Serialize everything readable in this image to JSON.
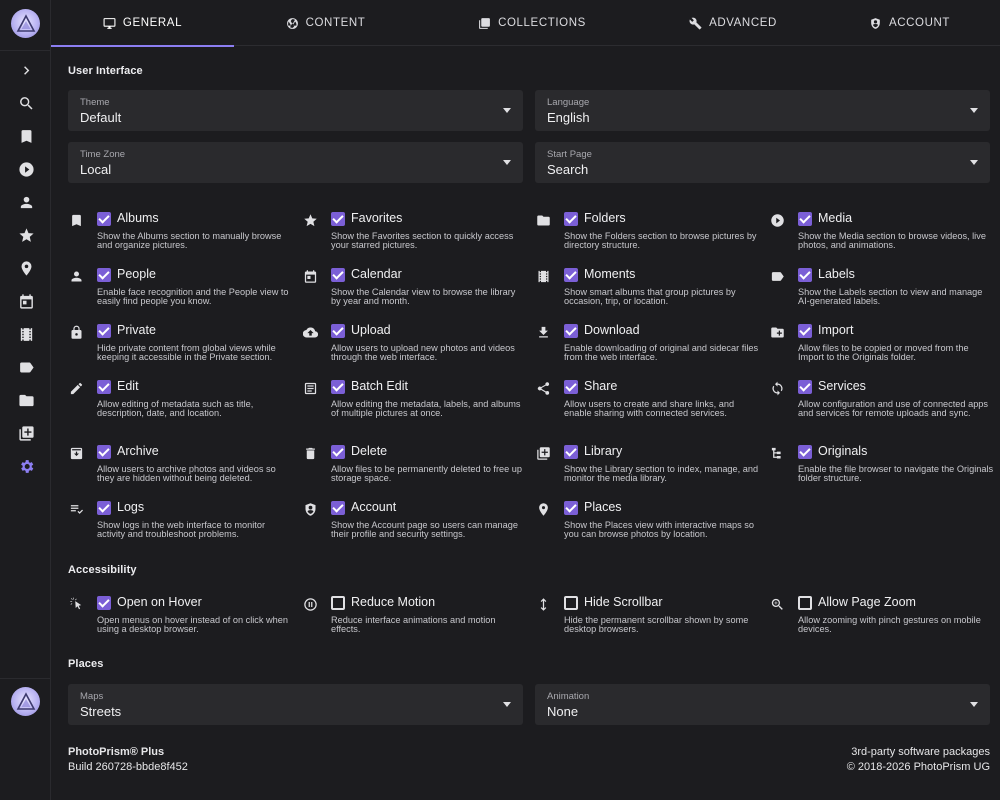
{
  "tabs": [
    {
      "label": "GENERAL",
      "icon": "monitor-icon"
    },
    {
      "label": "CONTENT",
      "icon": "aperture-icon"
    },
    {
      "label": "COLLECTIONS",
      "icon": "collections-icon"
    },
    {
      "label": "ADVANCED",
      "icon": "wrench-icon"
    },
    {
      "label": "ACCOUNT",
      "icon": "account-icon"
    }
  ],
  "accent_color": "#8c7ef2",
  "sections": {
    "ui_title": "User Interface",
    "accessibility_title": "Accessibility",
    "places_title": "Places"
  },
  "selects": {
    "theme": {
      "label": "Theme",
      "value": "Default"
    },
    "language": {
      "label": "Language",
      "value": "English"
    },
    "timezone": {
      "label": "Time Zone",
      "value": "Local"
    },
    "startpage": {
      "label": "Start Page",
      "value": "Search"
    },
    "maps": {
      "label": "Maps",
      "value": "Streets"
    },
    "animation": {
      "label": "Animation",
      "value": "None"
    }
  },
  "options": [
    {
      "name": "Albums",
      "desc": "Show the Albums section to manually browse and organize pictures.",
      "checked": true,
      "icon": "bookmark-icon"
    },
    {
      "name": "Favorites",
      "desc": "Show the Favorites section to quickly access your starred pictures.",
      "checked": true,
      "icon": "star-icon"
    },
    {
      "name": "Folders",
      "desc": "Show the Folders section to browse pictures by directory structure.",
      "checked": true,
      "icon": "folder-icon"
    },
    {
      "name": "Media",
      "desc": "Show the Media section to browse videos, live photos, and animations.",
      "checked": true,
      "icon": "play-circle-icon"
    },
    {
      "name": "People",
      "desc": "Enable face recognition and the People view to easily find people you know.",
      "checked": true,
      "icon": "person-icon"
    },
    {
      "name": "Calendar",
      "desc": "Show the Calendar view to browse the library by year and month.",
      "checked": true,
      "icon": "calendar-icon"
    },
    {
      "name": "Moments",
      "desc": "Show smart albums that group pictures by occasion, trip, or location.",
      "checked": true,
      "icon": "film-icon"
    },
    {
      "name": "Labels",
      "desc": "Show the Labels section to view and manage AI-generated labels.",
      "checked": true,
      "icon": "label-icon"
    },
    {
      "name": "Private",
      "desc": "Hide private content from global views while keeping it accessible in the Private section.",
      "checked": true,
      "icon": "lock-icon"
    },
    {
      "name": "Upload",
      "desc": "Allow users to upload new photos and videos through the web interface.",
      "checked": true,
      "icon": "cloud-upload-icon"
    },
    {
      "name": "Download",
      "desc": "Enable downloading of original and sidecar files from the web interface.",
      "checked": true,
      "icon": "download-icon"
    },
    {
      "name": "Import",
      "desc": "Allow files to be copied or moved from the Import to the Originals folder.",
      "checked": true,
      "icon": "folder-plus-icon"
    },
    {
      "name": "Edit",
      "desc": "Allow editing of metadata such as title, description, date, and location.",
      "checked": true,
      "icon": "pencil-icon"
    },
    {
      "name": "Batch Edit",
      "desc": "Allow editing the metadata, labels, and albums of multiple pictures at once.",
      "checked": true,
      "icon": "batch-edit-icon"
    },
    {
      "name": "Share",
      "desc": "Allow users to create and share links, and enable sharing with connected services.",
      "checked": true,
      "icon": "share-icon"
    },
    {
      "name": "Services",
      "desc": "Allow configuration and use of connected apps and services for remote uploads and sync.",
      "checked": true,
      "icon": "sync-icon"
    },
    {
      "name": "Archive",
      "desc": "Allow users to archive photos and videos so they are hidden without being deleted.",
      "checked": true,
      "icon": "archive-icon"
    },
    {
      "name": "Delete",
      "desc": "Allow files to be permanently deleted to free up storage space.",
      "checked": true,
      "icon": "trash-icon"
    },
    {
      "name": "Library",
      "desc": "Show the Library section to index, manage, and monitor the media library.",
      "checked": true,
      "icon": "library-icon"
    },
    {
      "name": "Originals",
      "desc": "Enable the file browser to navigate the Originals folder structure.",
      "checked": true,
      "icon": "file-tree-icon"
    },
    {
      "name": "Logs",
      "desc": "Show logs in the web interface to monitor activity and troubleshoot problems.",
      "checked": true,
      "icon": "logs-icon"
    },
    {
      "name": "Account",
      "desc": "Show the Account page so users can manage their profile and security settings.",
      "checked": true,
      "icon": "account-shield-icon"
    },
    {
      "name": "Places",
      "desc": "Show the Places view with interactive maps so you can browse photos by location.",
      "checked": true,
      "icon": "map-marker-icon"
    }
  ],
  "accessibility": [
    {
      "name": "Open on Hover",
      "desc": "Open menus on hover instead of on click when using a desktop browser.",
      "checked": true,
      "icon": "cursor-click-icon"
    },
    {
      "name": "Reduce Motion",
      "desc": "Reduce interface animations and motion effects.",
      "checked": false,
      "icon": "motion-pause-icon"
    },
    {
      "name": "Hide Scrollbar",
      "desc": "Hide the permanent scrollbar shown by some desktop browsers.",
      "checked": false,
      "icon": "vertical-arrows-icon"
    },
    {
      "name": "Allow Page Zoom",
      "desc": "Allow zooming with pinch gestures on mobile devices.",
      "checked": false,
      "icon": "zoom-icon"
    }
  ],
  "footer": {
    "product": "PhotoPrism® Plus",
    "build": "Build 260728-bbde8f452",
    "packages": "3rd-party software packages",
    "copyright": "© 2018-2026 PhotoPrism UG"
  },
  "sidebar": [
    "expand-icon",
    "search-icon",
    "bookmark-icon",
    "play-circle-icon",
    "person-icon",
    "star-icon",
    "map-marker-icon",
    "calendar-icon",
    "film-icon",
    "label-icon",
    "folder-icon",
    "library-icon",
    "settings-icon"
  ]
}
